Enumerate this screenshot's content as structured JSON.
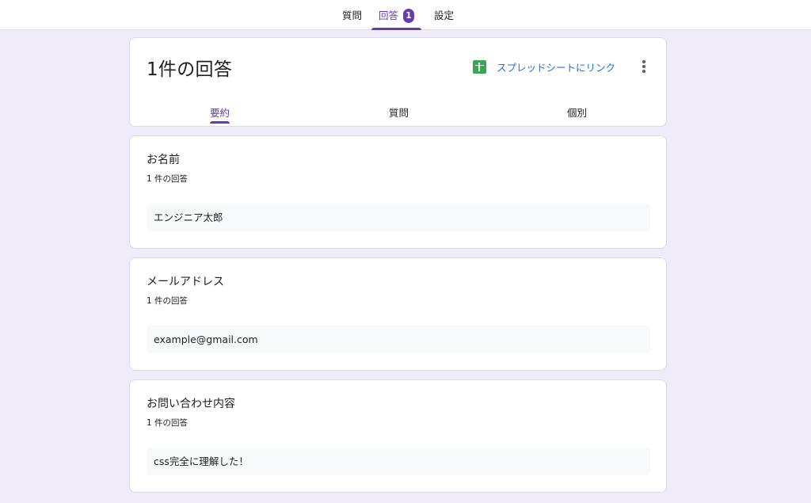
{
  "topnav": {
    "tabs": [
      {
        "label": "質問"
      },
      {
        "label": "回答",
        "badge": "1",
        "active": true
      },
      {
        "label": "設定"
      }
    ]
  },
  "summary": {
    "title": "1件の回答",
    "sheet_link_label": "スプレッドシートにリンク",
    "sheet_icon": "google-sheets-icon",
    "more_icon": "more-vert-icon",
    "tabs": [
      {
        "label": "要約",
        "active": true
      },
      {
        "label": "質問"
      },
      {
        "label": "個別"
      }
    ]
  },
  "questions": [
    {
      "title": "お名前",
      "count": "1 件の回答",
      "answer": "エンジニア太郎"
    },
    {
      "title": "メールアドレス",
      "count": "1 件の回答",
      "answer": "example@gmail.com"
    },
    {
      "title": "お問い合わせ内容",
      "count": "1 件の回答",
      "answer": "css完全に理解した！"
    }
  ],
  "colors": {
    "accent": "#673ab7",
    "link": "#1a73e8",
    "sheets": "#34a853",
    "background": "#f0ebf8"
  }
}
